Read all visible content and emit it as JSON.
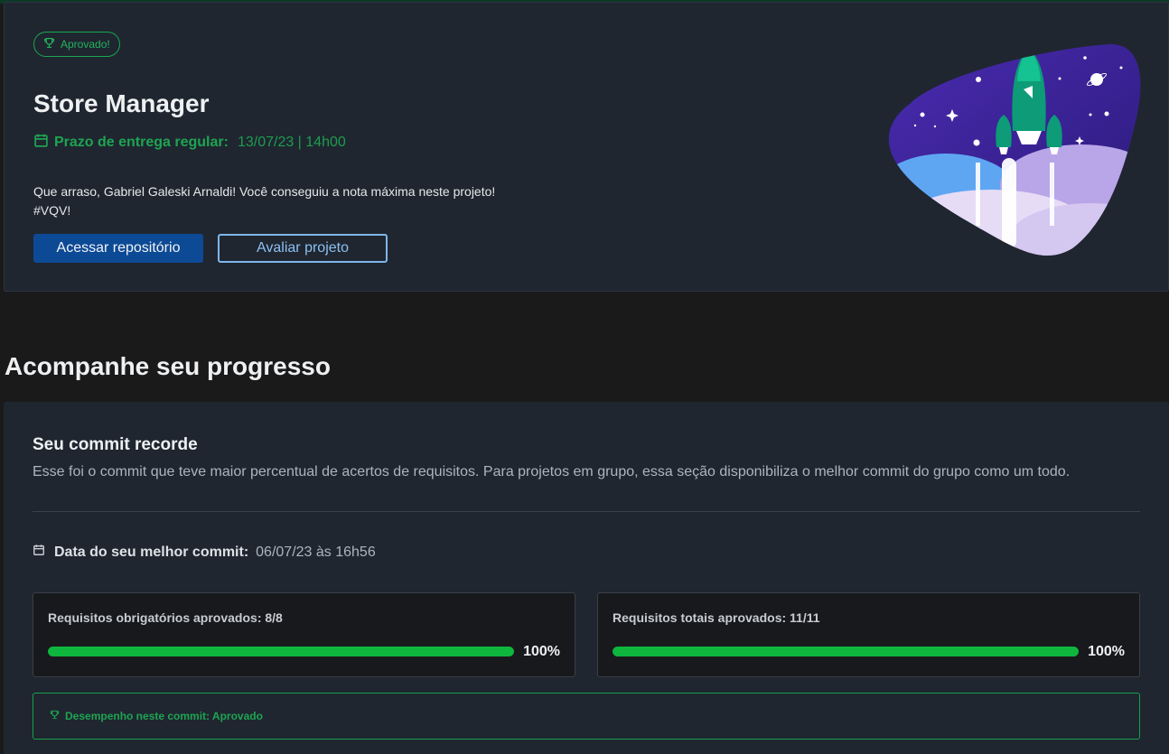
{
  "project": {
    "status_badge": "Aprovado!",
    "title": "Store Manager",
    "deadline_label": "Prazo de entrega regular:",
    "deadline_value": "13/07/23 | 14h00",
    "message_line1": "Que arraso, Gabriel Galeski Arnaldi! Você conseguiu a nota máxima neste projeto!",
    "message_line2": "#VQV!",
    "primary_button": "Acessar repositório",
    "secondary_button": "Avaliar projeto"
  },
  "progress": {
    "section_title": "Acompanhe seu progresso",
    "card_title": "Seu commit recorde",
    "card_description": "Esse foi o commit que teve maior percentual de acertos de requisitos. Para projetos em grupo, essa seção disponibiliza o melhor commit do grupo como um todo.",
    "best_commit_label": "Data do seu melhor commit:",
    "best_commit_value": "06/07/23 às 16h56",
    "mandatory": {
      "label": "Requisitos obrigatórios aprovados: 8/8",
      "percent_text": "100%",
      "percent": 100
    },
    "total": {
      "label": "Requisitos totais aprovados: 11/11",
      "percent_text": "100%",
      "percent": 100
    },
    "performance": "Desempenho neste commit: Aprovado"
  },
  "colors": {
    "success": "#18a94f",
    "progress_fill": "#0fb63e",
    "primary_button": "#0d4a95",
    "outline_button": "#7fb6ea",
    "card_bg": "#1f2630",
    "page_bg": "#1a1a1b"
  },
  "icons": {
    "badge": "trophy-icon",
    "deadline": "calendar-icon",
    "best_commit": "calendar-icon",
    "performance": "trophy-icon",
    "illustration": "rocket-illustration"
  }
}
